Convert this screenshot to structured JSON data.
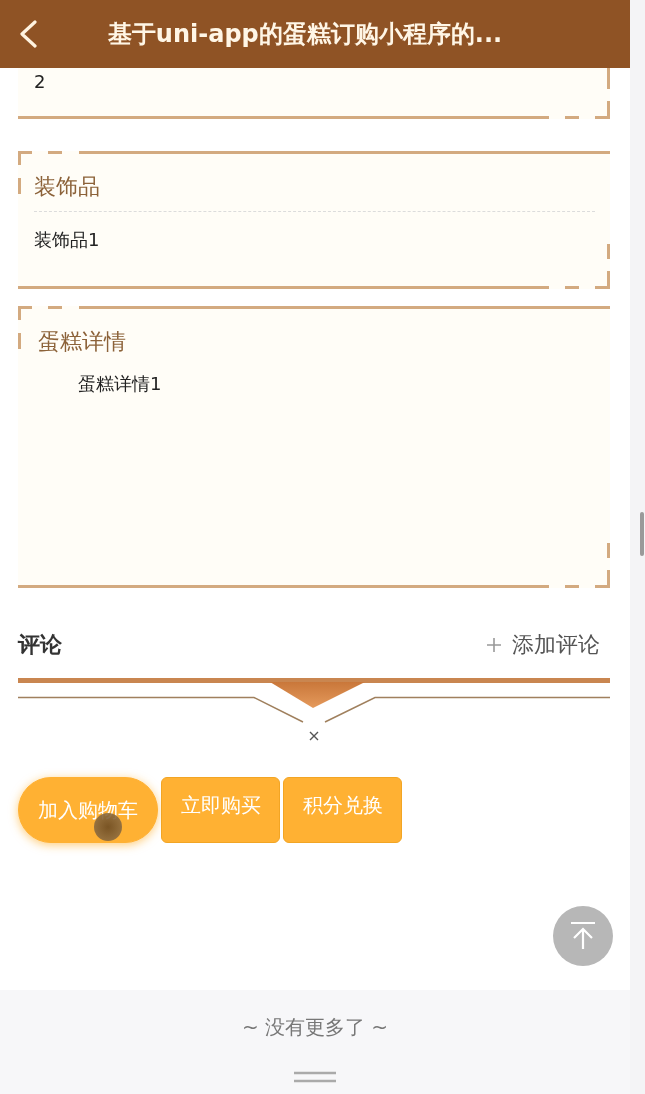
{
  "header": {
    "title": "基于uni-app的蛋糕订购小程序的..."
  },
  "sections": [
    {
      "kind": "plain",
      "text": "2"
    },
    {
      "kind": "divided",
      "title": "装饰品",
      "text": "装饰品1"
    },
    {
      "kind": "rich",
      "title": "蛋糕详情",
      "text": "蛋糕详情1"
    }
  ],
  "comments": {
    "title": "评论",
    "add_label": "添加评论"
  },
  "buttons": [
    {
      "kind": "pill",
      "label": "加入购物车"
    },
    {
      "kind": "box",
      "label": "立即购买"
    },
    {
      "kind": "box",
      "label": "积分兑换"
    }
  ],
  "footer": {
    "message": "~ 没有更多了 ~"
  }
}
